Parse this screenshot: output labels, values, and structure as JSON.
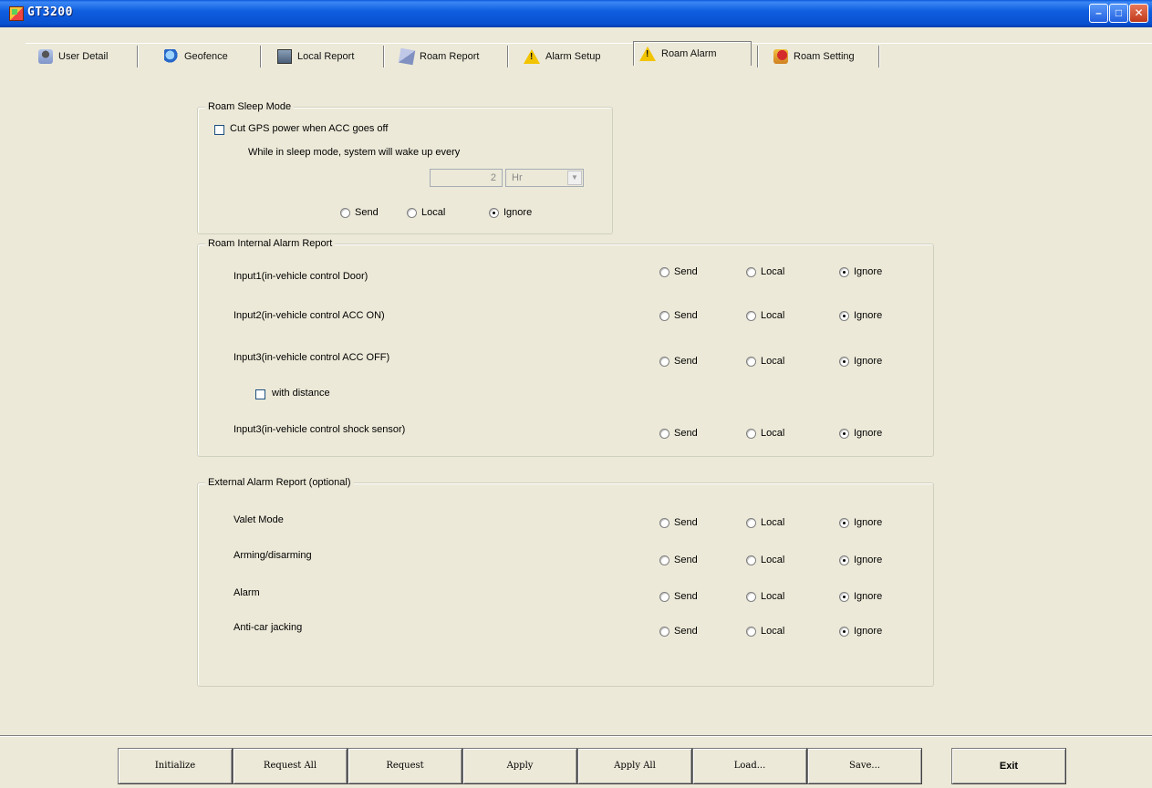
{
  "window": {
    "title": "GT3200"
  },
  "tabs": [
    {
      "label": "User Detail",
      "icon": "user-icon"
    },
    {
      "label": "Geofence",
      "icon": "globe-icon"
    },
    {
      "label": "Local Report",
      "icon": "monitor-icon"
    },
    {
      "label": "Roam Report",
      "icon": "roam-icon"
    },
    {
      "label": "Alarm Setup",
      "icon": "warning-icon"
    },
    {
      "label": "Roam Alarm",
      "icon": "warning-icon",
      "active": true
    },
    {
      "label": "Roam Setting",
      "icon": "settings-icon"
    }
  ],
  "sleep_mode": {
    "title": "Roam Sleep Mode",
    "cut_gps_label": "Cut GPS power when ACC goes off",
    "cut_gps_checked": false,
    "wake_text": "While in sleep mode, system will wake up every",
    "interval_value": "2",
    "interval_unit": "Hr",
    "selected": "Ignore"
  },
  "options": {
    "send": "Send",
    "local": "Local",
    "ignore": "Ignore"
  },
  "internal": {
    "title": "Roam Internal Alarm Report",
    "rows": [
      {
        "label": "Input1(in-vehicle control Door)",
        "selected": "Ignore"
      },
      {
        "label": "Input2(in-vehicle control ACC ON)",
        "selected": "Ignore"
      },
      {
        "label": "Input3(in-vehicle control ACC OFF)",
        "selected": "Ignore"
      },
      {
        "label": "Input3(in-vehicle control shock sensor)",
        "selected": "Ignore"
      }
    ],
    "with_distance_label": "with distance",
    "with_distance_checked": false
  },
  "external": {
    "title": "External Alarm Report (optional)",
    "rows": [
      {
        "label": "Valet Mode",
        "selected": "Ignore"
      },
      {
        "label": "Arming/disarming",
        "selected": "Ignore"
      },
      {
        "label": "Alarm",
        "selected": "Ignore"
      },
      {
        "label": "Anti-car jacking",
        "selected": "Ignore"
      }
    ]
  },
  "buttons": {
    "initialize": "Initialize",
    "request_all": "Request All",
    "request": "Request",
    "apply": "Apply",
    "apply_all": "Apply All",
    "load": "Load...",
    "save": "Save...",
    "exit": "Exit"
  },
  "colors": {
    "titlebar": "#0a5ad8",
    "face": "#ece9d8",
    "close": "#c0391a"
  }
}
